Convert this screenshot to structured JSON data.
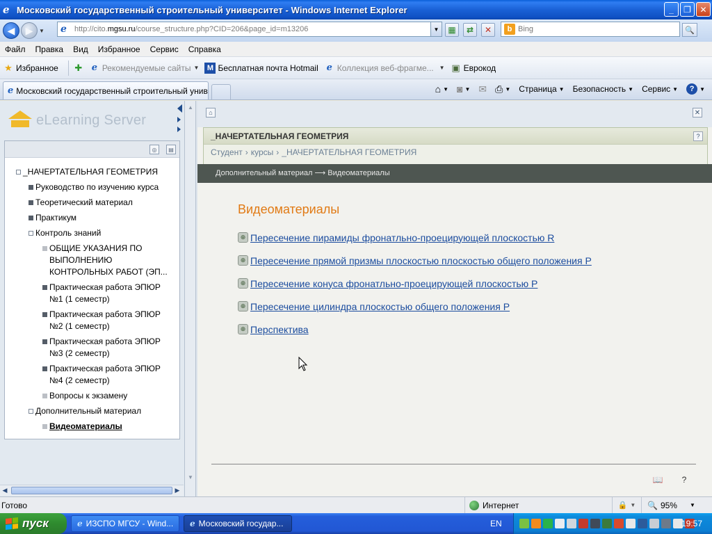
{
  "window": {
    "title": "Московский государственный строительный университет - Windows Internet Explorer"
  },
  "address": {
    "url_prefix": "http://cito.",
    "url_domain": "mgsu.ru",
    "url_path": "/course_structure.php?CID=206&page_id=m13206",
    "search_placeholder": "Bing"
  },
  "menu": [
    "Файл",
    "Правка",
    "Вид",
    "Избранное",
    "Сервис",
    "Справка"
  ],
  "favorites": {
    "favorites_label": "Избранное",
    "items": [
      {
        "label": "Рекомендуемые сайты",
        "dim": true,
        "has_arrow": true
      },
      {
        "label": "Бесплатная почта Hotmail",
        "dim": false
      },
      {
        "label": "Коллекция веб-фрагме...",
        "dim": true,
        "has_arrow": true
      },
      {
        "label": "Еврокод",
        "dim": false
      }
    ]
  },
  "tab": {
    "title": "Московский государственный строительный унив..."
  },
  "commands": [
    "Страница",
    "Безопасность",
    "Сервис"
  ],
  "sidebar": {
    "logo_text": "eLearning Server",
    "tree": [
      {
        "label": "_НАЧЕРТАТЕЛЬНАЯ ГЕОМЕТРИЯ",
        "level": 0,
        "bullet": "open",
        "lines": [
          "_НАЧЕРТАТЕЛЬНАЯ ГЕОМЕТРИЯ"
        ]
      },
      {
        "label": "Руководство по изучению курса",
        "level": 1,
        "bullet": "dark",
        "lines": [
          "Руководство по изучению курса"
        ]
      },
      {
        "label": "Теоретический материал",
        "level": 1,
        "bullet": "dark",
        "lines": [
          "Теоретический материал"
        ]
      },
      {
        "label": "Практикум",
        "level": 1,
        "bullet": "dark",
        "lines": [
          "Практикум"
        ]
      },
      {
        "label": "Контроль знаний",
        "level": 1,
        "bullet": "open",
        "lines": [
          "Контроль знаний"
        ]
      },
      {
        "label": "ОБЩИЕ УКАЗАНИЯ ПО ВЫПОЛНЕНИЮ КОНТРОЛЬНЫХ РАБОТ (ЭП...",
        "level": 2,
        "bullet": "light",
        "lines": [
          "ОБЩИЕ УКАЗАНИЯ ПО",
          "ВЫПОЛНЕНИЮ",
          "КОНТРОЛЬНЫХ РАБОТ (ЭП..."
        ]
      },
      {
        "label": "Практическая работа ЭПЮР №1 (1 семестр)",
        "level": 2,
        "bullet": "dark",
        "lines": [
          "Практическая работа ЭПЮР",
          "№1 (1 семестр)"
        ]
      },
      {
        "label": "Практическая работа ЭПЮР №2 (1 семестр)",
        "level": 2,
        "bullet": "dark",
        "lines": [
          "Практическая работа ЭПЮР",
          "№2 (1 семестр)"
        ]
      },
      {
        "label": "Практическая работа ЭПЮР №3 (2 семестр)",
        "level": 2,
        "bullet": "dark",
        "lines": [
          "Практическая работа ЭПЮР",
          "№3 (2 семестр)"
        ]
      },
      {
        "label": "Практическая работа ЭПЮР №4 (2 семестр)",
        "level": 2,
        "bullet": "dark",
        "lines": [
          "Практическая работа ЭПЮР",
          "№4 (2 семестр)"
        ]
      },
      {
        "label": "Вопросы к экзамену",
        "level": 2,
        "bullet": "light",
        "lines": [
          "Вопросы к экзамену"
        ]
      },
      {
        "label": "Дополнительный материал",
        "level": 1,
        "bullet": "open",
        "lines": [
          "Дополнительный материал"
        ]
      },
      {
        "label": "Видеоматериалы",
        "level": 2,
        "bullet": "light",
        "selected": true,
        "lines": [
          "Видеоматериалы"
        ]
      }
    ]
  },
  "main": {
    "course_title": "_НАЧЕРТАТЕЛЬНАЯ ГЕОМЕТРИЯ",
    "breadcrumbs": [
      "Студент",
      "курсы",
      "_НАЧЕРТАТЕЛЬНАЯ ГЕОМЕТРИЯ"
    ],
    "path_strip": "Дополнительный материал ⟶ Видеоматериалы",
    "section_title": "Видеоматериалы",
    "videos": [
      "Пересечение пирамиды фронатльно-проецирующей плоскостью R",
      "Пересечение прямой призмы плоскостью плоскостью общего положения Р",
      "Пересечение конуса фронатльно-проецирующей плоскостью Р",
      "Пересечение цилиндра плоскостью общего положения Р",
      "Перспектива"
    ]
  },
  "status": {
    "text": "Готово",
    "zone": "Интернет",
    "zoom": "95%"
  },
  "taskbar": {
    "start_label": "пуск",
    "buttons": [
      {
        "label": "ИЗСПО МГСУ - Wind...",
        "active": false
      },
      {
        "label": "Московский государ...",
        "active": true
      }
    ],
    "language": "EN",
    "clock": "19:57"
  },
  "colors": {
    "titlebar": "#0f51c4",
    "section_title": "#e17a14",
    "link": "#1b4c9e",
    "path_strip": "#4e5651",
    "taskbar": "#245edb",
    "start": "#2f8b2f"
  }
}
